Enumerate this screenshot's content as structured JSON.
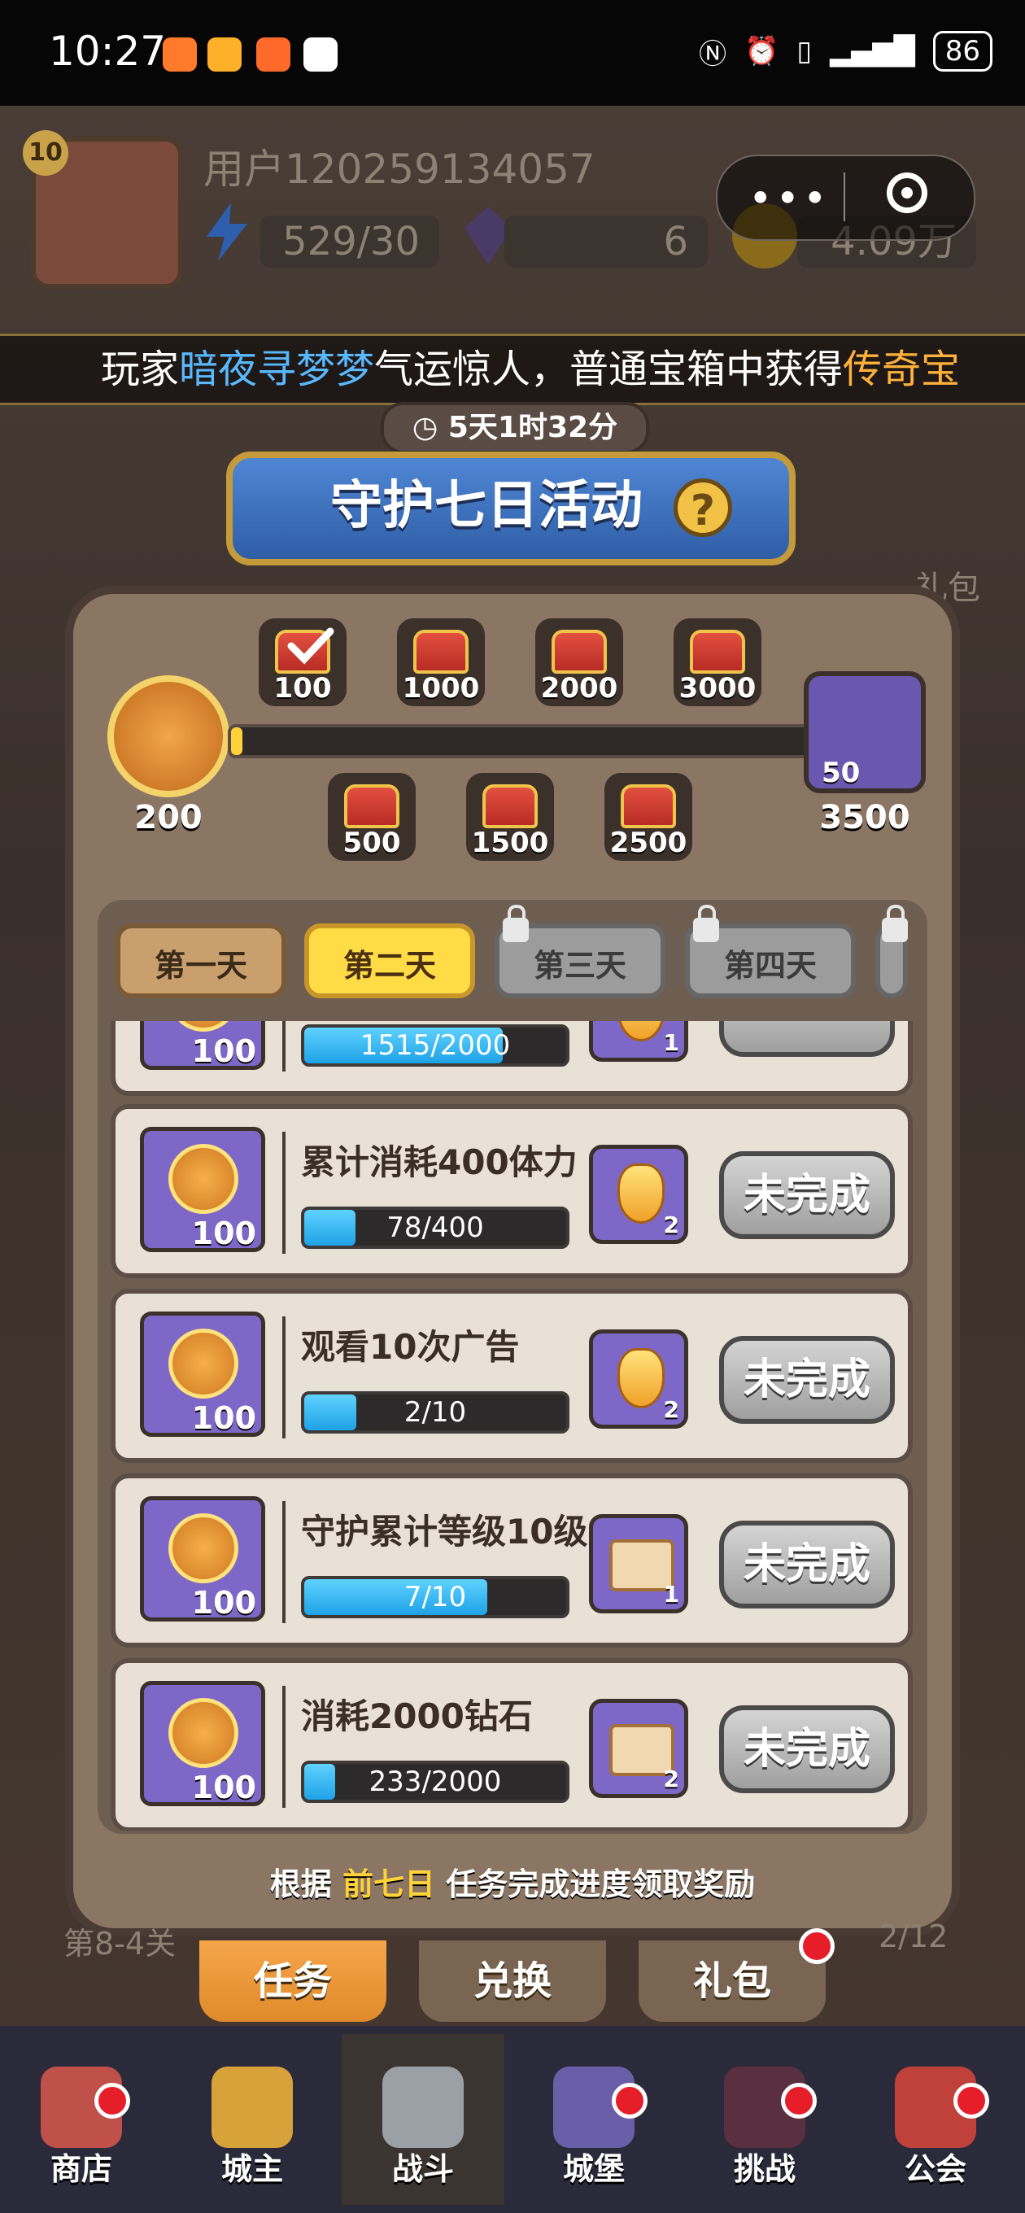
{
  "status_bar": {
    "time": "10:27",
    "battery": "86"
  },
  "header": {
    "level": "10",
    "username": "用户120259134057",
    "energy": "529/30",
    "gems": "6",
    "gold": "4.09万"
  },
  "marquee": {
    "prefix": "玩家",
    "player": "暗夜寻梦梦",
    "middle": "气运惊人，普通宝箱中获得",
    "item": "传奇宝"
  },
  "event": {
    "timer": "5天1时32分",
    "title": "守护七日活动",
    "help": "?",
    "medal_count": "200",
    "progress": 0.02,
    "boss_value": "3500",
    "boss_badge": "50",
    "chests_top": [
      {
        "label": "100",
        "claimed": true
      },
      {
        "label": "1000",
        "claimed": false
      },
      {
        "label": "2000",
        "claimed": false
      },
      {
        "label": "3000",
        "claimed": false
      }
    ],
    "chests_bottom": [
      {
        "label": "500"
      },
      {
        "label": "1500"
      },
      {
        "label": "2500"
      }
    ]
  },
  "days": [
    {
      "label": "第一天",
      "state": "done"
    },
    {
      "label": "第二天",
      "state": "active"
    },
    {
      "label": "第三天",
      "state": "locked"
    },
    {
      "label": "第四天",
      "state": "locked"
    }
  ],
  "tasks": [
    {
      "title": "",
      "medal": "100",
      "progress": "1515/2000",
      "fraction": 0.7575,
      "reward_count": "1",
      "reward_type": "gem",
      "button": ""
    },
    {
      "title": "累计消耗400体力",
      "medal": "100",
      "progress": "78/400",
      "fraction": 0.195,
      "reward_count": "2",
      "reward_type": "gem",
      "button": "未完成"
    },
    {
      "title": "观看10次广告",
      "medal": "100",
      "progress": "2/10",
      "fraction": 0.2,
      "reward_count": "2",
      "reward_type": "gem",
      "button": "未完成"
    },
    {
      "title": "守护累计等级10级",
      "medal": "100",
      "progress": "7/10",
      "fraction": 0.7,
      "reward_count": "1",
      "reward_type": "book",
      "button": "未完成"
    },
    {
      "title": "消耗2000钻石",
      "medal": "100",
      "progress": "233/2000",
      "fraction": 0.1165,
      "reward_count": "2",
      "reward_type": "book",
      "button": "未完成"
    }
  ],
  "footer_note": {
    "before": "根据",
    "highlight": "前七日",
    "after": "任务完成进度领取奖励"
  },
  "bottom_tabs": {
    "tasks": "任务",
    "exchange": "兑换",
    "gift": "礼包",
    "left_label": "第8-4关",
    "right_label": "2/12"
  },
  "side_labels": {
    "gift_pack": "礼包"
  },
  "nav": [
    {
      "label": "商店",
      "icon": "shop-icon"
    },
    {
      "label": "城主",
      "icon": "crown-icon"
    },
    {
      "label": "战斗",
      "icon": "swords-icon"
    },
    {
      "label": "城堡",
      "icon": "castle-icon"
    },
    {
      "label": "挑战",
      "icon": "skull-icon"
    },
    {
      "label": "公会",
      "icon": "guild-flag-icon"
    }
  ],
  "colors": {
    "accent_yellow": "#ffd23a",
    "task_progress": "#1ea2e6",
    "banner_blue": "#2f5ea6",
    "red_dot": "#e61e2a"
  }
}
